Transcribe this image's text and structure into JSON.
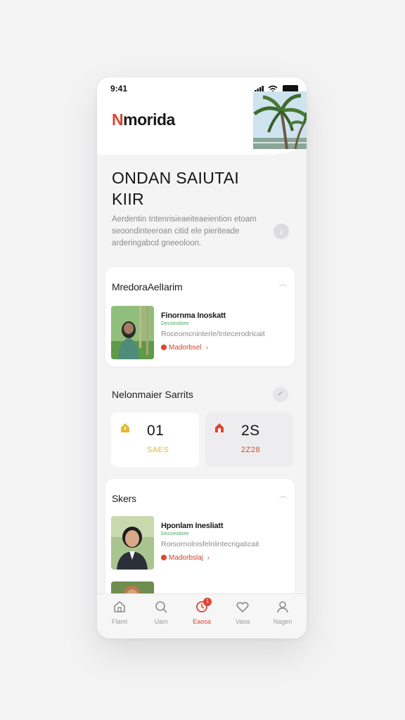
{
  "status": {
    "time": "9:41"
  },
  "brand": {
    "first_letter": "N",
    "rest": "morida"
  },
  "hero": {
    "headline": "ONDAN SAIUTAI KIIR",
    "description": "Aerdentin Intenrisieaeiteaeiention etoam seoondinteeroan citid ele pieriteade arderingabcd gneeoloon."
  },
  "card1": {
    "title": "MredoraAelIarim",
    "item": {
      "name": "Finornma Inoskatt",
      "tag": "Decoeobtee",
      "sub": "Roceomcninterle/Intecerodricait",
      "location": "Madorbsel"
    }
  },
  "stats_section": {
    "title": "Nelonmaier Sarrits",
    "stats": [
      {
        "value": "01",
        "sub": "SAES",
        "color": "#e8b92b"
      },
      {
        "value": "2S",
        "sub": "2Z28",
        "color": "#e2452f"
      }
    ]
  },
  "card2": {
    "title": "Skers",
    "item": {
      "name": "Hponlam Inesliatt",
      "tag": "Decoeobtee",
      "sub": "Rorsornolnisfelnlintecrigaticait",
      "location": "Madorbslaj"
    }
  },
  "tabbar": {
    "badge": "1",
    "tabs": [
      {
        "label": "Flaml",
        "icon": "home-icon"
      },
      {
        "label": "Uam",
        "icon": "search-icon"
      },
      {
        "label": "Eaosa",
        "icon": "notification-icon"
      },
      {
        "label": "Vaoa",
        "icon": "heart-icon"
      },
      {
        "label": "Nagen",
        "icon": "user-icon"
      }
    ]
  },
  "colors": {
    "accent": "#e2452f",
    "success": "#3fae5a",
    "warning": "#e8b92b"
  }
}
